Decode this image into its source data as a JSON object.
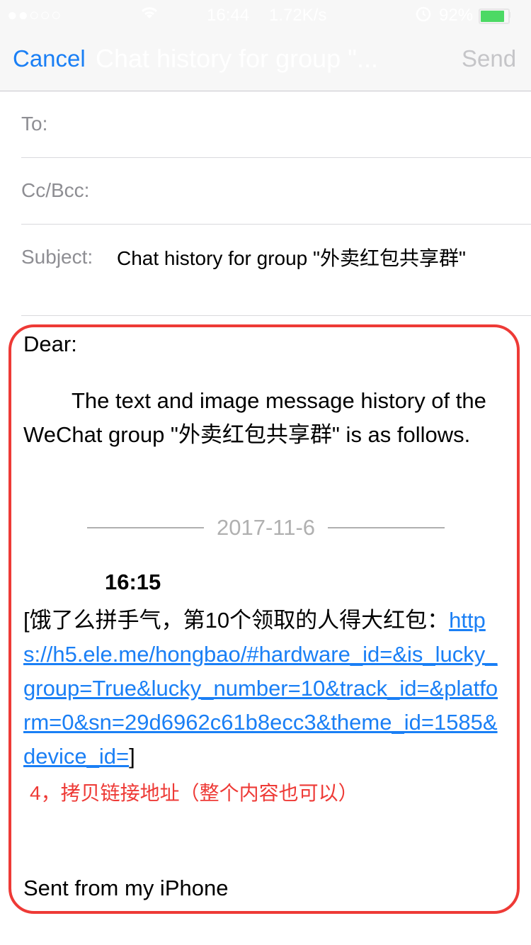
{
  "status_bar": {
    "signal": "●●○○○",
    "wifi_icon": "wifi-icon",
    "time": "16:44",
    "speed": "1.72K/s",
    "alarm_icon": "alarm-icon",
    "battery_pct": "92%",
    "battery_level": 0.92,
    "battery_color": "#4cd964"
  },
  "nav": {
    "cancel_label": "Cancel",
    "title": "Chat history for group \"...",
    "send_label": "Send",
    "accent": "#1a7ff5"
  },
  "fields": {
    "to_label": "To:",
    "cc_label": "Cc/Bcc:",
    "subject_label": "Subject:",
    "subject_value": "Chat history for group \"外卖红包共享群\""
  },
  "body": {
    "greeting": "Dear:",
    "intro": "The text and image message history of the WeChat group \"外卖红包共享群\" is as follows.",
    "date": "2017-11-6",
    "message_time": "16:15",
    "message_prefix": "[饿了么拼手气，第10个领取的人得大红包：",
    "message_link": "https://h5.ele.me/hongbao/#hardware_id=&is_lucky_group=True&lucky_number=10&track_id=&platform=0&sn=29d6962c61b8ecc3&theme_id=1585&device_id=",
    "message_suffix": "]",
    "annotation": "4，拷贝链接地址（整个内容也可以）",
    "signature": "Sent from my iPhone",
    "highlight_color": "#ee3a36"
  }
}
